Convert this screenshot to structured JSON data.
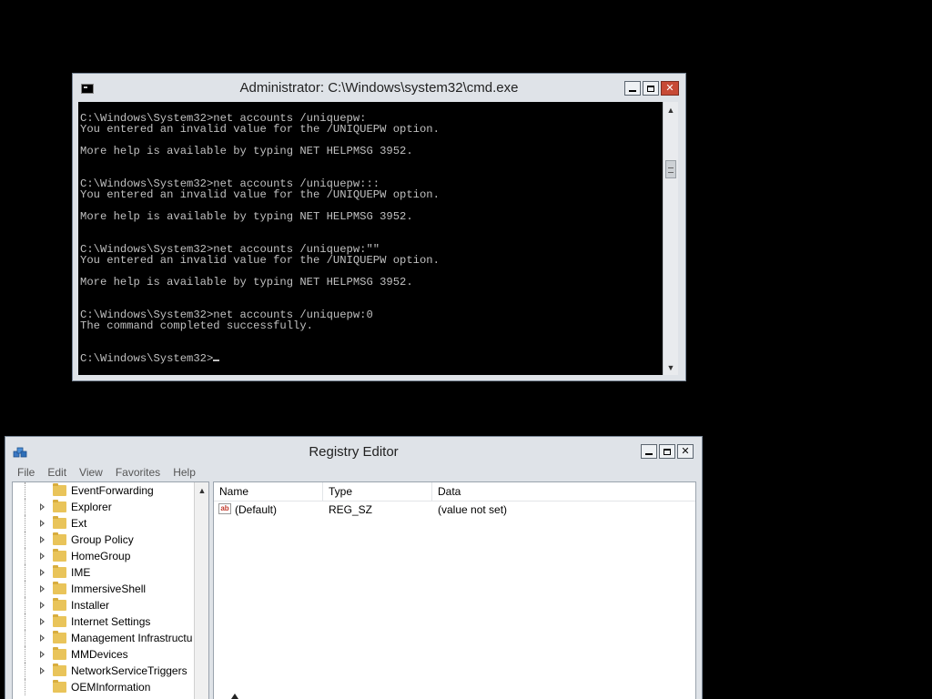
{
  "cmd": {
    "title": "Administrator: C:\\Windows\\system32\\cmd.exe",
    "output": "\nC:\\Windows\\System32>net accounts /uniquepw:\nYou entered an invalid value for the /UNIQUEPW option.\n\nMore help is available by typing NET HELPMSG 3952.\n\n\nC:\\Windows\\System32>net accounts /uniquepw:::\nYou entered an invalid value for the /UNIQUEPW option.\n\nMore help is available by typing NET HELPMSG 3952.\n\n\nC:\\Windows\\System32>net accounts /uniquepw:\"\"\nYou entered an invalid value for the /UNIQUEPW option.\n\nMore help is available by typing NET HELPMSG 3952.\n\n\nC:\\Windows\\System32>net accounts /uniquepw:0\nThe command completed successfully.\n\n\nC:\\Windows\\System32>",
    "controls": {
      "minimize": "minimize-icon",
      "maximize": "maximize-icon",
      "close": "close-icon"
    }
  },
  "registry": {
    "title": "Registry Editor",
    "menu": [
      "File",
      "Edit",
      "View",
      "Favorites",
      "Help"
    ],
    "tree_items": [
      {
        "label": "EventForwarding",
        "expandable": false
      },
      {
        "label": "Explorer",
        "expandable": true
      },
      {
        "label": "Ext",
        "expandable": true
      },
      {
        "label": "Group Policy",
        "expandable": true
      },
      {
        "label": "HomeGroup",
        "expandable": true
      },
      {
        "label": "IME",
        "expandable": true
      },
      {
        "label": "ImmersiveShell",
        "expandable": true
      },
      {
        "label": "Installer",
        "expandable": true
      },
      {
        "label": "Internet Settings",
        "expandable": true
      },
      {
        "label": "Management Infrastructure",
        "expandable": true
      },
      {
        "label": "MMDevices",
        "expandable": true
      },
      {
        "label": "NetworkServiceTriggers",
        "expandable": true
      },
      {
        "label": "OEMInformation",
        "expandable": false
      }
    ],
    "columns": {
      "name": "Name",
      "type": "Type",
      "data": "Data"
    },
    "values": [
      {
        "name": "(Default)",
        "type": "REG_SZ",
        "data": "(value not set)",
        "icon": "ab"
      }
    ]
  }
}
